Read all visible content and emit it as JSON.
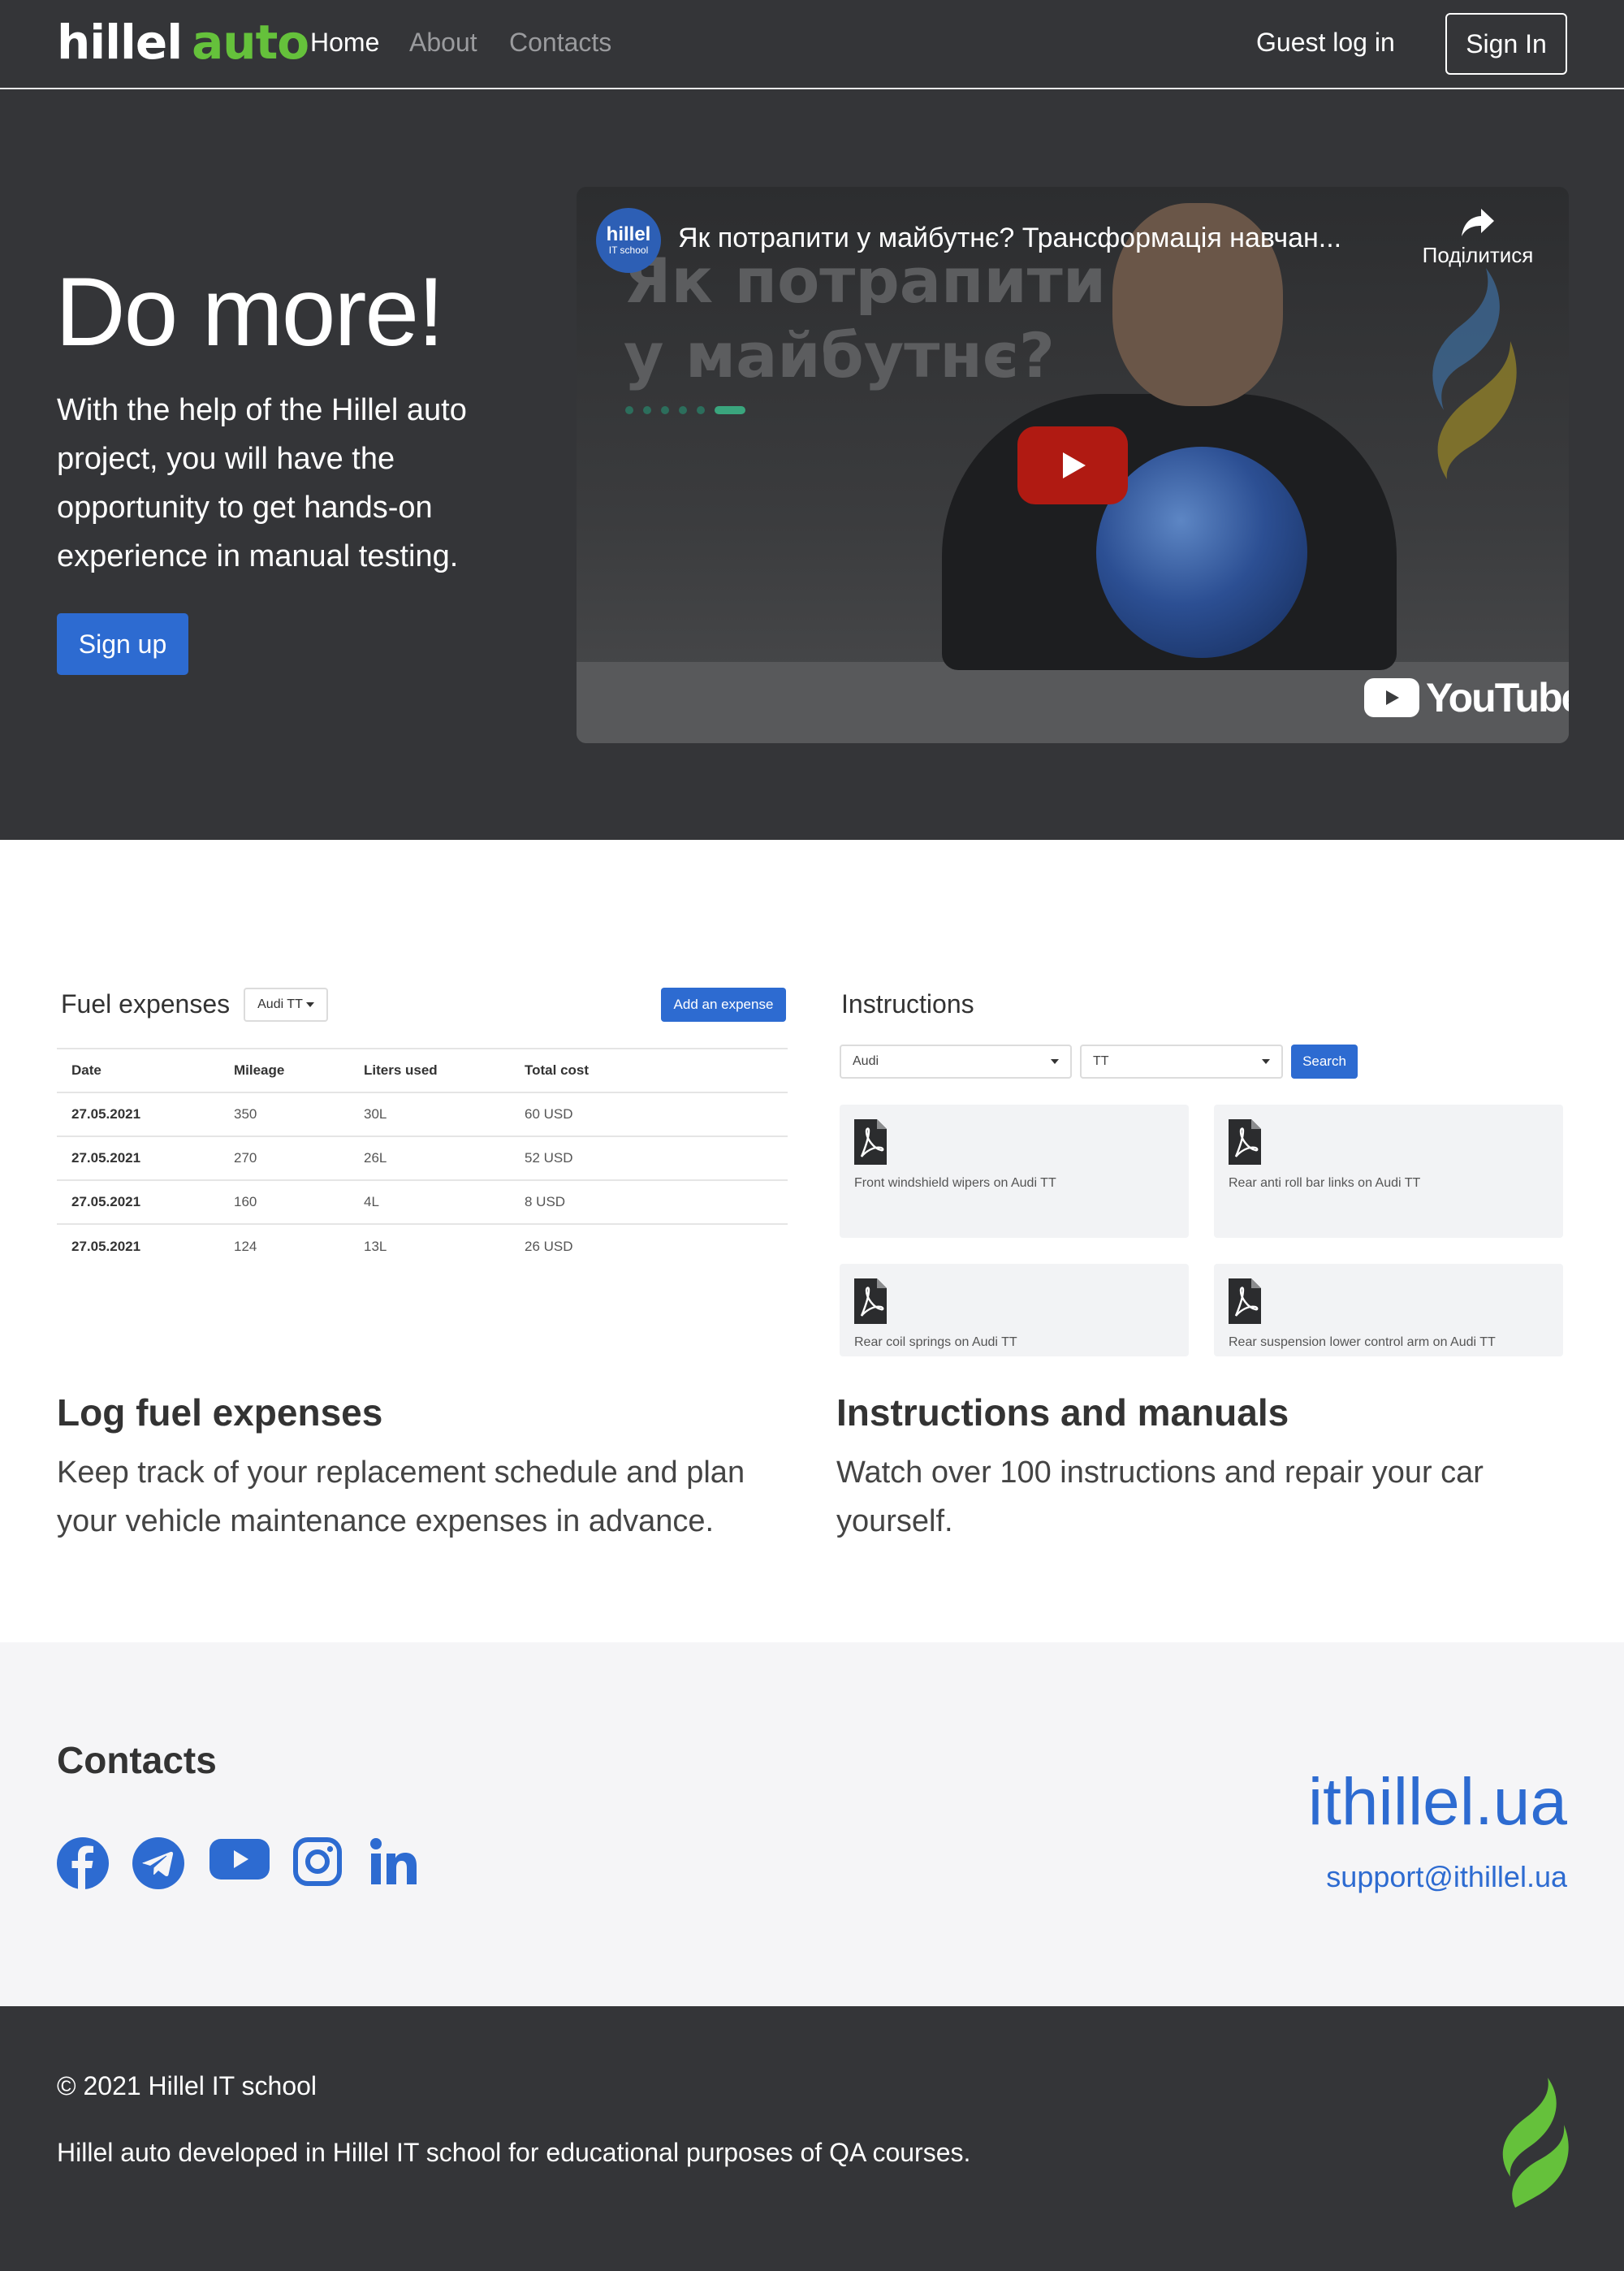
{
  "header": {
    "logo_white": "hillel",
    "logo_green": "auto",
    "nav": [
      "Home",
      "About",
      "Contacts"
    ],
    "guest_login": "Guest log in",
    "sign_in": "Sign In"
  },
  "hero": {
    "title": "Do more!",
    "text": "With the help of the Hillel auto project, you will have the opportunity to get hands-on experience in manual testing.",
    "signup": "Sign up",
    "video": {
      "channel_name": "hillel",
      "channel_sub": "IT school",
      "title": "Як потрапити у майбутнє? Трансформація навчан...",
      "share_label": "Поділитися",
      "overlay_line1": "Як потрапити",
      "overlay_line2": "у майбутнє?",
      "brand": "YouTube"
    }
  },
  "fuel": {
    "title": "Fuel expenses",
    "car_select": "Audi TT",
    "add_button": "Add an expense",
    "columns": [
      "Date",
      "Mileage",
      "Liters used",
      "Total cost"
    ],
    "rows": [
      [
        "27.05.2021",
        "350",
        "30L",
        "60 USD"
      ],
      [
        "27.05.2021",
        "270",
        "26L",
        "52 USD"
      ],
      [
        "27.05.2021",
        "160",
        "4L",
        "8 USD"
      ],
      [
        "27.05.2021",
        "124",
        "13L",
        "26 USD"
      ]
    ]
  },
  "instructions": {
    "title": "Instructions",
    "brand_select": "Audi",
    "model_select": "TT",
    "search_button": "Search",
    "items": [
      "Front windshield wipers on Audi TT",
      "Rear anti roll bar links on Audi TT",
      "Rear coil springs on Audi TT",
      "Rear suspension lower control arm on Audi TT"
    ]
  },
  "features": [
    {
      "heading": "Log fuel expenses",
      "text": "Keep track of your replacement schedule and plan your vehicle maintenance expenses in advance."
    },
    {
      "heading": "Instructions and manuals",
      "text": "Watch over 100 instructions and repair your car yourself."
    }
  ],
  "contacts": {
    "heading": "Contacts",
    "social": [
      "facebook-icon",
      "telegram-icon",
      "youtube-icon",
      "instagram-icon",
      "linkedin-icon"
    ],
    "site": "ithillel.ua",
    "email": "support@ithillel.ua"
  },
  "footer": {
    "copyright": "© 2021 Hillel IT school",
    "text": "Hillel auto developed in Hillel IT school for educational purposes of QA courses."
  },
  "colors": {
    "header_bg": "#343538",
    "brand_green": "#65c13b",
    "accent_blue": "#2d6bd1",
    "contacts_bg": "#f5f5f7"
  }
}
